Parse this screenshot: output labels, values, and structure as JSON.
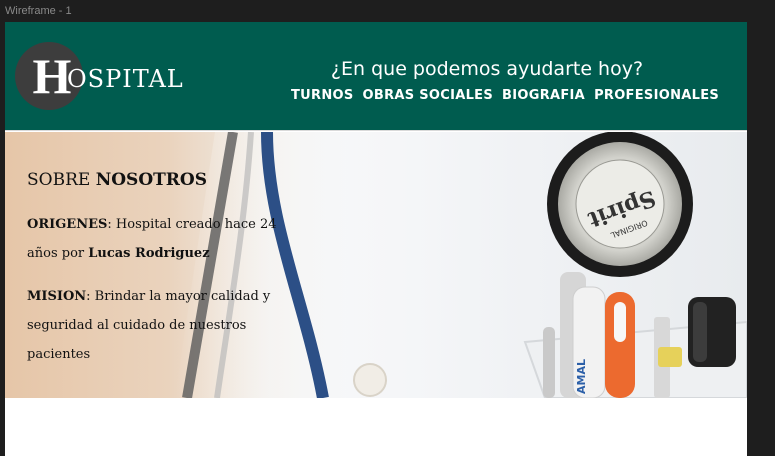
{
  "window": {
    "frame_label": "Wireframe - 1"
  },
  "header": {
    "logo_initial": "H",
    "logo_rest": "OSPITAL",
    "help_text": "¿En que podemos ayudarte hoy?",
    "nav": [
      {
        "label": "TURNOS"
      },
      {
        "label": "OBRAS SOCIALES"
      },
      {
        "label": "BIOGRAFIA"
      },
      {
        "label": "PROFESIONALES"
      }
    ]
  },
  "about": {
    "title_light": "SOBRE ",
    "title_bold": "NOSOTROS",
    "origins_label": "ORIGENES",
    "origins_text": ": Hospital creado hace 24 años por ",
    "origins_name": "Lucas Rodriguez",
    "mission_label": "MISION",
    "mission_text": ": Brindar la mayor calidad y seguridad al cuidado de nuestros pacientes"
  },
  "hero_image": {
    "badge_text": "Spirit",
    "badge_subtext": "ORIGINAL",
    "pen_text": "AMAL"
  },
  "colors": {
    "header_bg": "#005c4f",
    "logo_circle": "#3d3d3d",
    "canvas_bg": "#1e1e1e"
  }
}
